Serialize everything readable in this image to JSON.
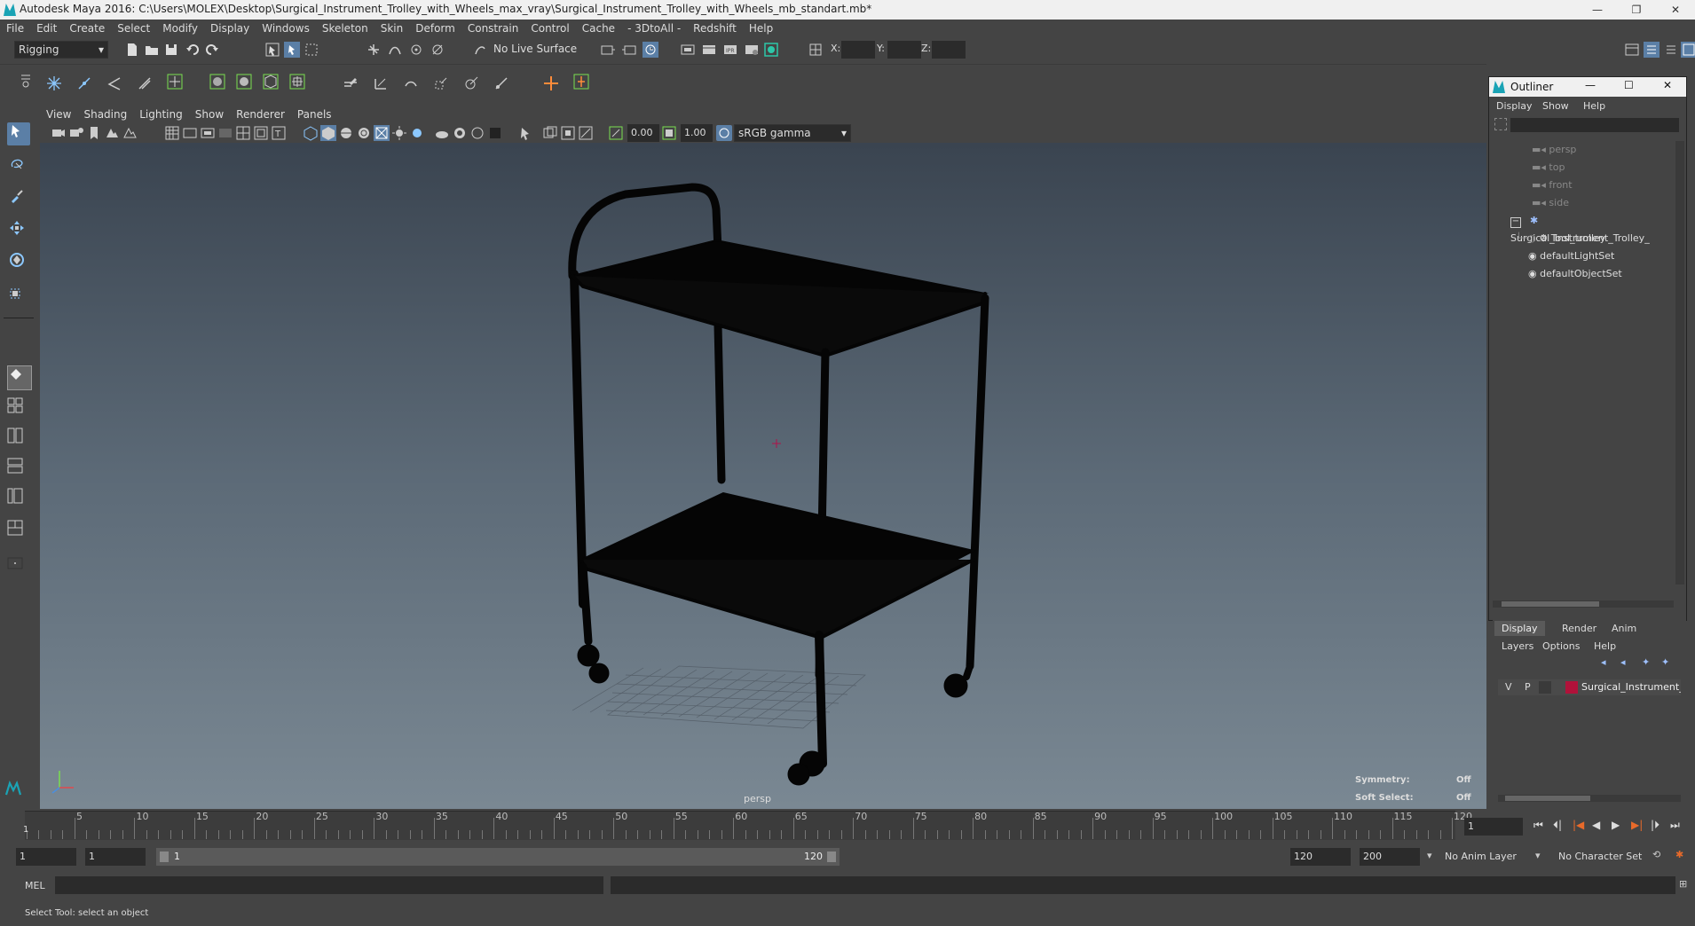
{
  "window": {
    "title": "Autodesk Maya 2016: C:\\Users\\MOLEX\\Desktop\\Surgical_Instrument_Trolley_with_Wheels_max_vray\\Surgical_Instrument_Trolley_with_Wheels_mb_standart.mb*",
    "controls": [
      "—",
      "❐",
      "✕"
    ]
  },
  "menu": [
    "File",
    "Edit",
    "Create",
    "Select",
    "Modify",
    "Display",
    "Windows",
    "Skeleton",
    "Skin",
    "Deform",
    "Constrain",
    "Control",
    "Cache",
    "- 3DtoAll -",
    "Redshift",
    "Help"
  ],
  "status": {
    "mode": "Rigging",
    "live_surface": "No Live Surface",
    "x_label": "X:",
    "y_label": "Y:",
    "z_label": "Z:"
  },
  "panel": {
    "menus": [
      "View",
      "Shading",
      "Lighting",
      "Show",
      "Renderer",
      "Panels"
    ],
    "exposure": "0.00",
    "gamma": "1.00",
    "colorspace": "sRGB gamma",
    "camera_label": "persp",
    "hud": {
      "symmetry_label": "Symmetry:",
      "symmetry_value": "Off",
      "soft_label": "Soft Select:",
      "soft_value": "Off"
    }
  },
  "outliner": {
    "title": "Outliner",
    "menus": [
      "Display",
      "Show",
      "Help"
    ],
    "items": [
      {
        "label": "persp",
        "dim": true
      },
      {
        "label": "top",
        "dim": true
      },
      {
        "label": "front",
        "dim": true
      },
      {
        "label": "side",
        "dim": true
      },
      {
        "label": "Surgical_Instrument_Trolley_",
        "dim": false
      },
      {
        "label": "Tool_trolley",
        "dim": false
      },
      {
        "label": "defaultLightSet",
        "dim": false
      },
      {
        "label": "defaultObjectSet",
        "dim": false
      }
    ]
  },
  "layers": {
    "tabs": [
      "Display",
      "Render",
      "Anim"
    ],
    "menus": [
      "Layers",
      "Options",
      "Help"
    ],
    "row": {
      "v": "V",
      "p": "P",
      "name": "Surgical_Instrument_Tı",
      "color": "#b0123a"
    }
  },
  "timeline": {
    "ticks": [
      "5",
      "10",
      "15",
      "20",
      "25",
      "30",
      "35",
      "40",
      "45",
      "50",
      "55",
      "60",
      "65",
      "70",
      "75",
      "80",
      "85",
      "90",
      "95",
      "100",
      "105",
      "110",
      "115",
      "120"
    ],
    "start_marker": "1",
    "current_frame": "1"
  },
  "range": {
    "start": "1",
    "playback_start": "1",
    "slider_start": "1",
    "slider_end": "120",
    "playback_end": "120",
    "end": "200",
    "anim_layer": "No Anim Layer",
    "character_set": "No Character Set"
  },
  "mel": {
    "label": "MEL"
  },
  "help": {
    "text": "Select Tool: select an object"
  }
}
